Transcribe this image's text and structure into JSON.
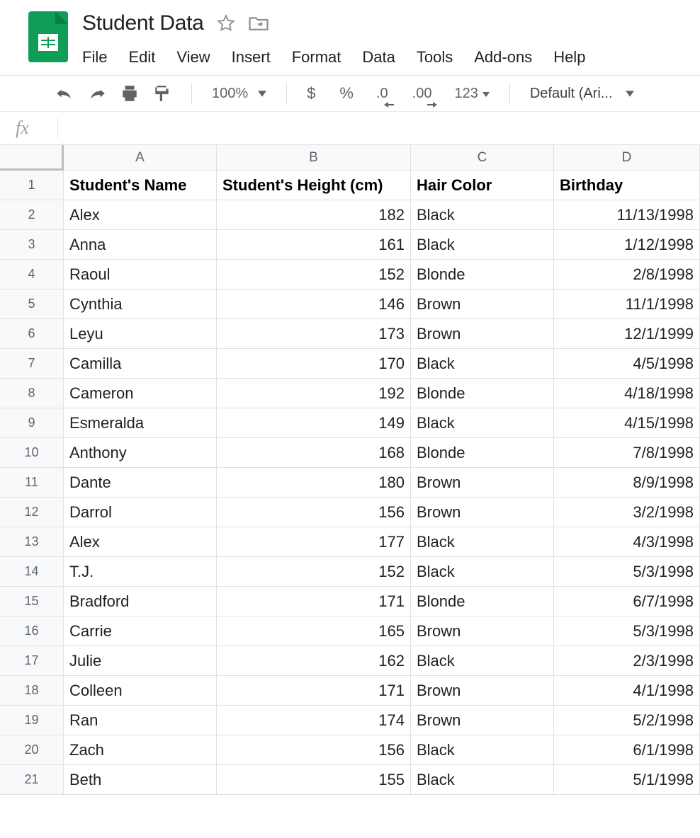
{
  "document": {
    "title": "Student Data"
  },
  "menu": {
    "file": "File",
    "edit": "Edit",
    "view": "View",
    "insert": "Insert",
    "format": "Format",
    "data": "Data",
    "tools": "Tools",
    "addons": "Add-ons",
    "help": "Help"
  },
  "toolbar": {
    "zoom": "100%",
    "currency": "$",
    "percent": "%",
    "dec_decrease": ".0",
    "dec_increase": ".00",
    "number_format": "123",
    "font": "Default (Ari..."
  },
  "formula": {
    "fx": "fx",
    "value": ""
  },
  "columns": [
    "A",
    "B",
    "C",
    "D"
  ],
  "headers": {
    "name": "Student's Name",
    "height": "Student's Height (cm)",
    "hair": "Hair Color",
    "birthday": "Birthday"
  },
  "rows": [
    {
      "n": "2",
      "name": "Alex",
      "height": "182",
      "hair": "Black",
      "birthday": "11/13/1998"
    },
    {
      "n": "3",
      "name": "Anna",
      "height": "161",
      "hair": "Black",
      "birthday": "1/12/1998"
    },
    {
      "n": "4",
      "name": "Raoul",
      "height": "152",
      "hair": "Blonde",
      "birthday": "2/8/1998"
    },
    {
      "n": "5",
      "name": "Cynthia",
      "height": "146",
      "hair": "Brown",
      "birthday": "11/1/1998"
    },
    {
      "n": "6",
      "name": "Leyu",
      "height": "173",
      "hair": "Brown",
      "birthday": "12/1/1999"
    },
    {
      "n": "7",
      "name": "Camilla",
      "height": "170",
      "hair": "Black",
      "birthday": "4/5/1998"
    },
    {
      "n": "8",
      "name": "Cameron",
      "height": "192",
      "hair": "Blonde",
      "birthday": "4/18/1998"
    },
    {
      "n": "9",
      "name": "Esmeralda",
      "height": "149",
      "hair": "Black",
      "birthday": "4/15/1998"
    },
    {
      "n": "10",
      "name": "Anthony",
      "height": "168",
      "hair": "Blonde",
      "birthday": "7/8/1998"
    },
    {
      "n": "11",
      "name": "Dante",
      "height": "180",
      "hair": "Brown",
      "birthday": "8/9/1998"
    },
    {
      "n": "12",
      "name": "Darrol",
      "height": "156",
      "hair": "Brown",
      "birthday": "3/2/1998"
    },
    {
      "n": "13",
      "name": "Alex",
      "height": "177",
      "hair": "Black",
      "birthday": "4/3/1998"
    },
    {
      "n": "14",
      "name": "T.J.",
      "height": "152",
      "hair": "Black",
      "birthday": "5/3/1998"
    },
    {
      "n": "15",
      "name": "Bradford",
      "height": "171",
      "hair": "Blonde",
      "birthday": "6/7/1998"
    },
    {
      "n": "16",
      "name": "Carrie",
      "height": "165",
      "hair": "Brown",
      "birthday": "5/3/1998"
    },
    {
      "n": "17",
      "name": "Julie",
      "height": "162",
      "hair": "Black",
      "birthday": "2/3/1998"
    },
    {
      "n": "18",
      "name": "Colleen",
      "height": "171",
      "hair": "Brown",
      "birthday": "4/1/1998"
    },
    {
      "n": "19",
      "name": "Ran",
      "height": "174",
      "hair": "Brown",
      "birthday": "5/2/1998"
    },
    {
      "n": "20",
      "name": "Zach",
      "height": "156",
      "hair": "Black",
      "birthday": "6/1/1998"
    },
    {
      "n": "21",
      "name": "Beth",
      "height": "155",
      "hair": "Black",
      "birthday": "5/1/1998"
    }
  ]
}
